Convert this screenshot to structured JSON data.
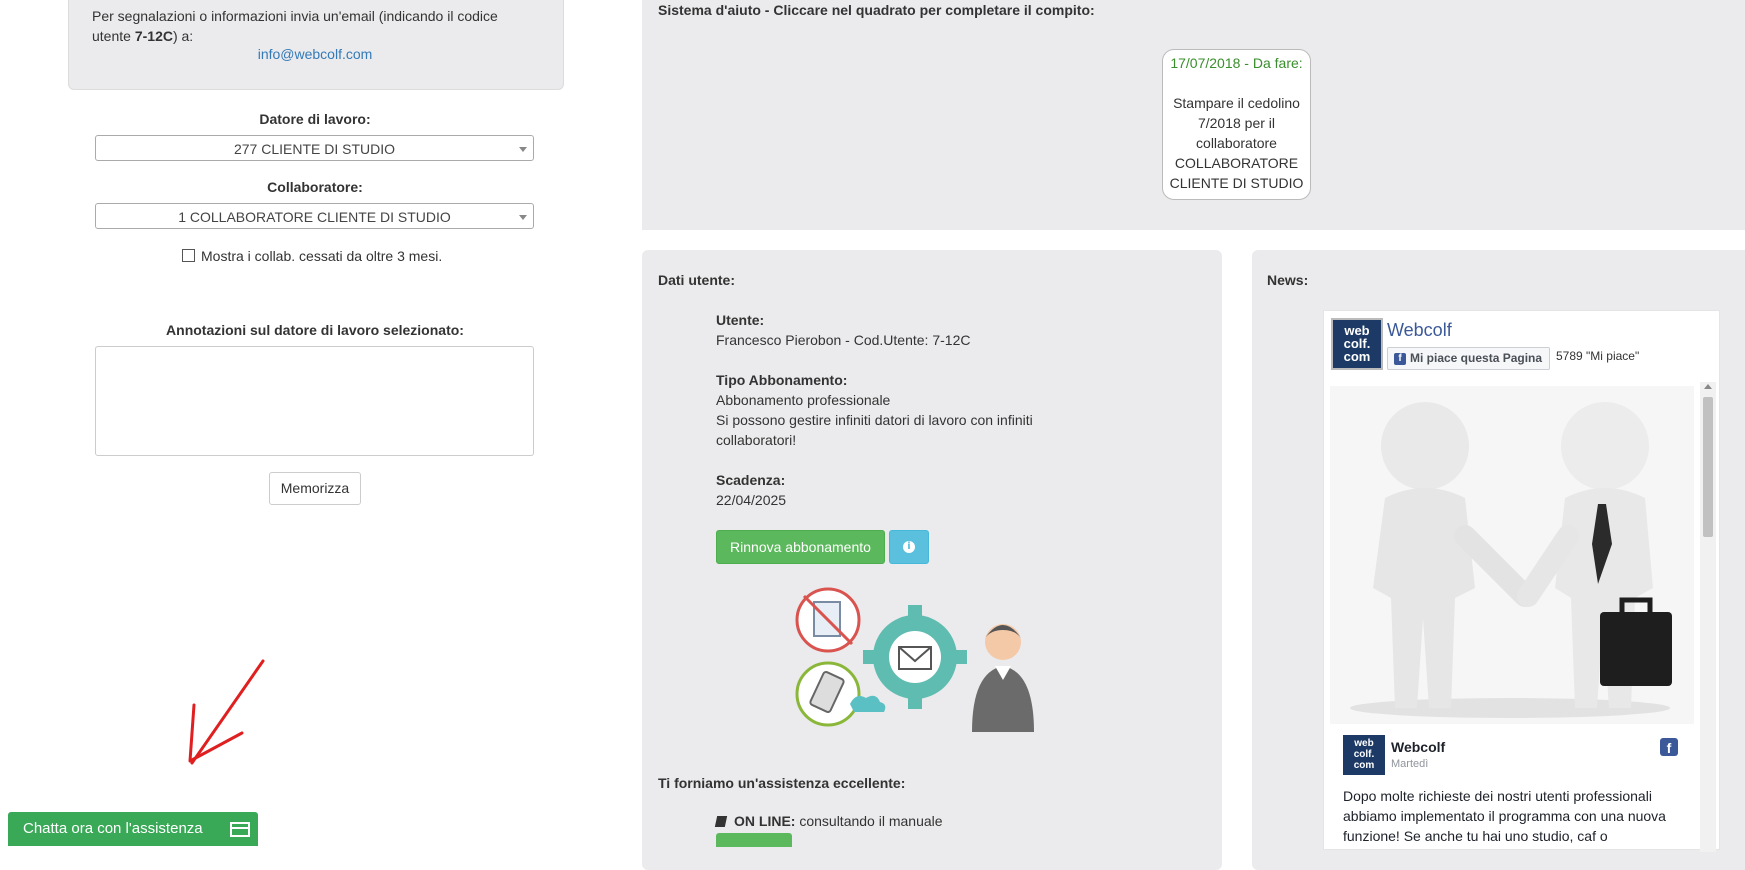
{
  "contact": {
    "text_line1": "Per segnalazioni o informazioni invia un'email (indicando il codice",
    "text_line2_prefix": "utente ",
    "user_code": "7-12C",
    "text_line2_suffix": ") a:",
    "email": "info@webcolf.com"
  },
  "employer": {
    "label": "Datore di lavoro:",
    "selected": "277 CLIENTE DI STUDIO"
  },
  "collaborator": {
    "label": "Collaboratore:",
    "selected": "1 COLLABORATORE CLIENTE DI STUDIO"
  },
  "show_ceased": {
    "label": "Mostra i collab. cessati da oltre 3 mesi.",
    "checked": false
  },
  "notes": {
    "label": "Annotazioni sul datore di lavoro selezionato:",
    "value": "",
    "save_label": "Memorizza"
  },
  "chat": {
    "label": "Chatta ora con l'assistenza"
  },
  "help": {
    "title": "Sistema d'aiuto - Cliccare nel quadrato per completare il compito:",
    "task": {
      "date_status": "17/07/2018 - Da fare:",
      "lines": [
        "Stampare il cedolino",
        "7/2018 per il",
        "collaboratore",
        "COLLABORATORE",
        "CLIENTE DI STUDIO"
      ]
    }
  },
  "user_data": {
    "title": "Dati utente:",
    "user_label": "Utente:",
    "user_value": "Francesco Pierobon - Cod.Utente: 7-12C",
    "subscription_label": "Tipo Abbonamento:",
    "subscription_value": "Abbonamento professionale",
    "subscription_desc_1": "Si possono gestire infiniti datori di lavoro con infiniti",
    "subscription_desc_2": "collaboratori!",
    "expiry_label": "Scadenza:",
    "expiry_value": "22/04/2025",
    "renew_label": "Rinnova abbonamento",
    "info_glyph": "i",
    "assist_title": "Ti forniamo un'assistenza eccellente:",
    "online_label": "ON LINE:",
    "online_text": " consultando il manuale"
  },
  "news": {
    "title": "News:",
    "page_name": "Webcolf",
    "logo_lines": [
      "web",
      "colf.",
      "com"
    ],
    "like_button": "Mi piace questa Pagina",
    "like_count": "5789 \"Mi piace\"",
    "post_author": "Webcolf",
    "post_date": "Martedì",
    "post_text": "Dopo molte richieste dei nostri utenti professionali abbiamo implementato il programma con una nuova funzione! Se anche tu hai uno studio, caf o"
  },
  "colors": {
    "accent_green": "#5cb85c",
    "info_blue": "#5bc0de",
    "link_blue": "#337ab7",
    "fb_blue": "#3b5998",
    "panel_bg": "#ebebed"
  }
}
